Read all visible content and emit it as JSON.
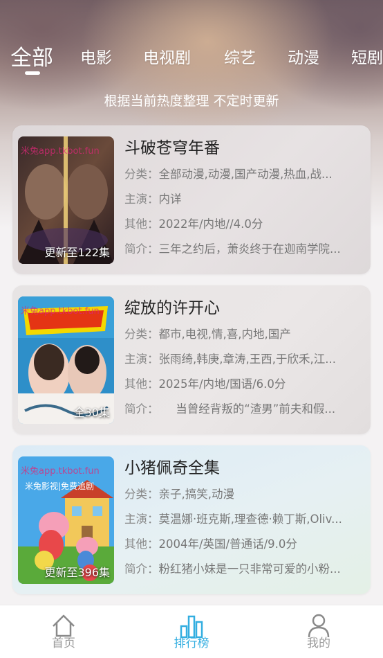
{
  "tabs": [
    "全部",
    "电影",
    "电视剧",
    "综艺",
    "动漫",
    "短剧"
  ],
  "active_tab": "全部",
  "subtitle": "根据当前热度整理 不定时更新",
  "labels": {
    "category": "分类：",
    "cast": "主演：",
    "other": "其他：",
    "intro": "简介："
  },
  "items": [
    {
      "title": "斗破苍穹年番",
      "badge": "更新至122集",
      "category": "全部动漫,动漫,国产动漫,热血,战...",
      "cast": "内详",
      "other": "2022年/内地//4.0分",
      "intro": "三年之约后，萧炎终于在迦南学院...",
      "watermark": "米兔app.tkbot.fun"
    },
    {
      "title": "绽放的许开心",
      "badge": "全30集",
      "category": "都市,电视,情,喜,内地,国产",
      "cast": "张雨绮,韩庚,章涛,王西,于欣禾,江...",
      "other": "2025年/内地/国语/6.0分",
      "intro": "　　当曾经背叛的“渣男”前夫和假...",
      "watermark": "米兔app.tkbot.fun"
    },
    {
      "title": "小猪佩奇全集",
      "badge": "更新至396集",
      "category": "亲子,搞笑,动漫",
      "cast": "莫温娜·班克斯,理查德·赖丁斯,Oliv...",
      "other": "2004年/英国/普通话/9.0分",
      "intro": "粉红猪小妹是一只非常可爱的小粉...",
      "watermark": "米兔app.tkbot.fun",
      "watermark2": "米兔影视|免费追剧"
    }
  ],
  "nav": [
    {
      "label": "首页",
      "icon": "home-icon"
    },
    {
      "label": "排行榜",
      "icon": "ranking-icon",
      "active": true
    },
    {
      "label": "我的",
      "icon": "user-icon"
    }
  ],
  "colors": {
    "accent": "#33aee0",
    "nav_inactive": "#9a9a9a"
  }
}
